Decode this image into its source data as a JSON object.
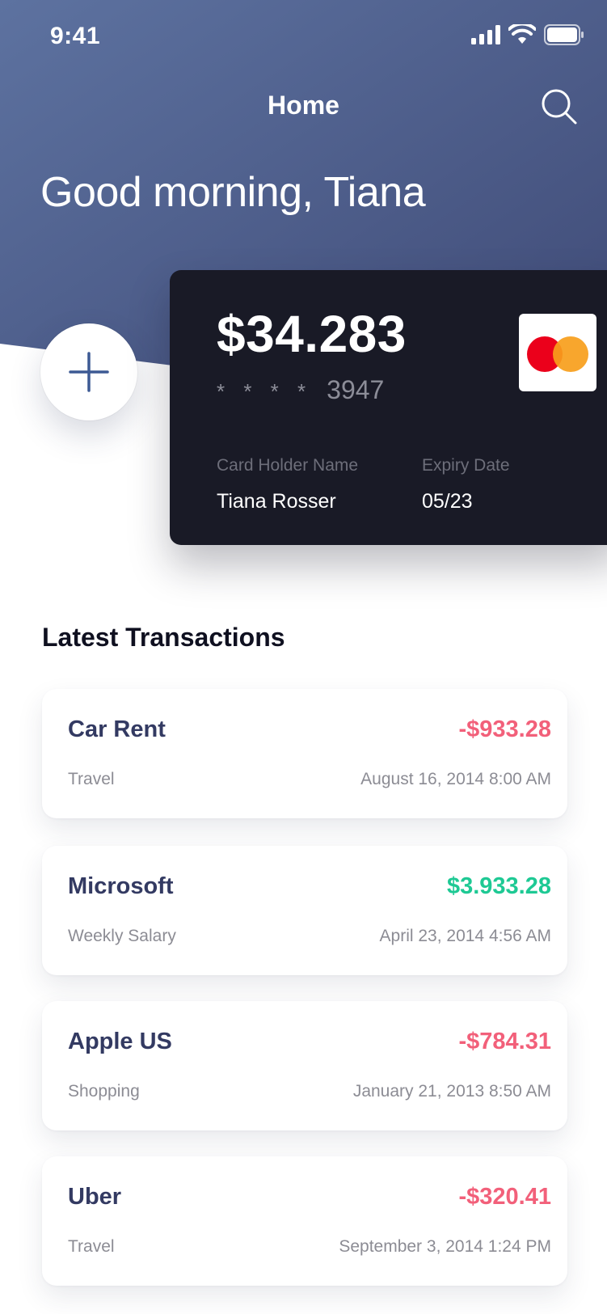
{
  "status_bar": {
    "time": "9:41"
  },
  "nav": {
    "title": "Home",
    "search_icon": "search-icon"
  },
  "greeting": "Good morning, Tiana",
  "add_button": {
    "icon": "plus-icon"
  },
  "card": {
    "balance": "$34.283",
    "number_mask": "* * * *",
    "last4": "3947",
    "holder_label": "Card Holder Name",
    "holder_name": "Tiana Rosser",
    "expiry_label": "Expiry Date",
    "expiry_value": "05/23",
    "brand_icon": "mastercard-logo"
  },
  "transactions": {
    "title": "Latest Transactions",
    "items": [
      {
        "name": "Car Rent",
        "amount": "-$933.28",
        "category": "Travel",
        "date": "August 16, 2014 8:00 AM",
        "amount_color": "#f2607a"
      },
      {
        "name": "Microsoft",
        "amount": "$3.933.28",
        "category": "Weekly Salary",
        "date": "April 23, 2014 4:56 AM",
        "amount_color": "#1ec994"
      },
      {
        "name": "Apple US",
        "amount": "-$784.31",
        "category": "Shopping",
        "date": "January 21, 2013 8:50 AM",
        "amount_color": "#f2607a"
      },
      {
        "name": "Uber",
        "amount": "-$320.41",
        "category": "Travel",
        "date": "September 3, 2014 1:24 PM",
        "amount_color": "#f2607a"
      }
    ]
  },
  "colors": {
    "header_gradient_start": "#5d72a0",
    "header_gradient_end": "#3f4a76",
    "card_background": "#191a26",
    "text_primary": "#333a62",
    "negative": "#f2607a",
    "positive": "#1ec994"
  }
}
